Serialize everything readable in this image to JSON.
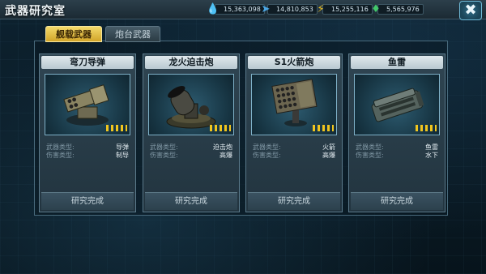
{
  "header": {
    "title": "武器研究室",
    "close_label": "✖"
  },
  "resources": [
    {
      "icon": "purple-gem-icon",
      "glyph": "💧",
      "color": "#b57be0",
      "value": "15,363,098"
    },
    {
      "icon": "blue-arrow-icon",
      "glyph": "➤",
      "color": "#4aa7e6",
      "value": "14,810,853"
    },
    {
      "icon": "gold-bolt-icon",
      "glyph": "⚡",
      "color": "#f0c020",
      "value": "15,255,116"
    },
    {
      "icon": "green-crystal-icon",
      "glyph": "♦",
      "color": "#42c86a",
      "value": "5,565,976"
    }
  ],
  "tabs": [
    {
      "label": "舰载武器",
      "active": true
    },
    {
      "label": "炮台武器",
      "active": false
    }
  ],
  "cards": [
    {
      "name": "弯刀导弹",
      "weapon_type_label": "武器类型:",
      "weapon_type": "导弹",
      "damage_type_label": "伤害类型:",
      "damage_type": "制导",
      "status": "研究完成",
      "image": "missile-launcher-icon"
    },
    {
      "name": "龙火迫击炮",
      "weapon_type_label": "武器类型:",
      "weapon_type": "迫击炮",
      "damage_type_label": "伤害类型:",
      "damage_type": "高爆",
      "status": "研究完成",
      "image": "mortar-icon"
    },
    {
      "name": "S1火箭炮",
      "weapon_type_label": "武器类型:",
      "weapon_type": "火箭",
      "damage_type_label": "伤害类型:",
      "damage_type": "高爆",
      "status": "研究完成",
      "image": "rocket-launcher-icon"
    },
    {
      "name": "鱼雷",
      "weapon_type_label": "武器类型:",
      "weapon_type": "鱼雷",
      "damage_type_label": "伤害类型:",
      "damage_type": "水下",
      "status": "研究完成",
      "image": "torpedo-launcher-icon"
    }
  ]
}
